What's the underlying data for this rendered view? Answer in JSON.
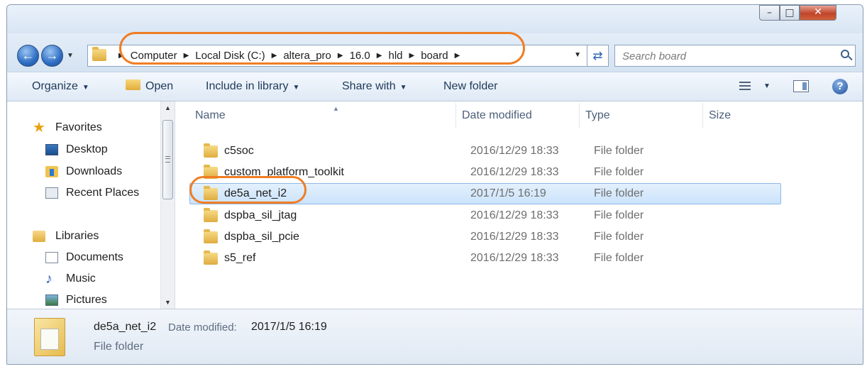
{
  "address_bar": {
    "crumbs": [
      "Computer",
      "Local Disk (C:)",
      "altera_pro",
      "16.0",
      "hld",
      "board"
    ]
  },
  "search": {
    "placeholder": "Search board"
  },
  "toolbar": {
    "organize": "Organize",
    "open": "Open",
    "include_in_library": "Include in library",
    "share_with": "Share with",
    "new_folder": "New folder"
  },
  "nav_pane": {
    "favorites": {
      "label": "Favorites",
      "items": [
        {
          "label": "Desktop",
          "icon": "desktop-icon"
        },
        {
          "label": "Downloads",
          "icon": "downloads-icon"
        },
        {
          "label": "Recent Places",
          "icon": "recent-places-icon"
        }
      ]
    },
    "libraries": {
      "label": "Libraries",
      "items": [
        {
          "label": "Documents",
          "icon": "documents-icon"
        },
        {
          "label": "Music",
          "icon": "music-icon"
        },
        {
          "label": "Pictures",
          "icon": "pictures-icon"
        }
      ]
    }
  },
  "columns": [
    "Name",
    "Date modified",
    "Type",
    "Size"
  ],
  "files": [
    {
      "name": "c5soc",
      "date": "2016/12/29 18:33",
      "type": "File folder",
      "size": ""
    },
    {
      "name": "custom_platform_toolkit",
      "date": "2016/12/29 18:33",
      "type": "File folder",
      "size": ""
    },
    {
      "name": "de5a_net_i2",
      "date": "2017/1/5 16:19",
      "type": "File folder",
      "size": "",
      "selected": true
    },
    {
      "name": "dspba_sil_jtag",
      "date": "2016/12/29 18:33",
      "type": "File folder",
      "size": ""
    },
    {
      "name": "dspba_sil_pcie",
      "date": "2016/12/29 18:33",
      "type": "File folder",
      "size": ""
    },
    {
      "name": "s5_ref",
      "date": "2016/12/29 18:33",
      "type": "File folder",
      "size": ""
    }
  ],
  "details": {
    "name": "de5a_net_i2",
    "date_label": "Date modified:",
    "date_value": "2017/1/5 16:19",
    "type": "File folder"
  },
  "colors": {
    "highlight": "#f07d24",
    "selection": "#cbe3fb"
  }
}
